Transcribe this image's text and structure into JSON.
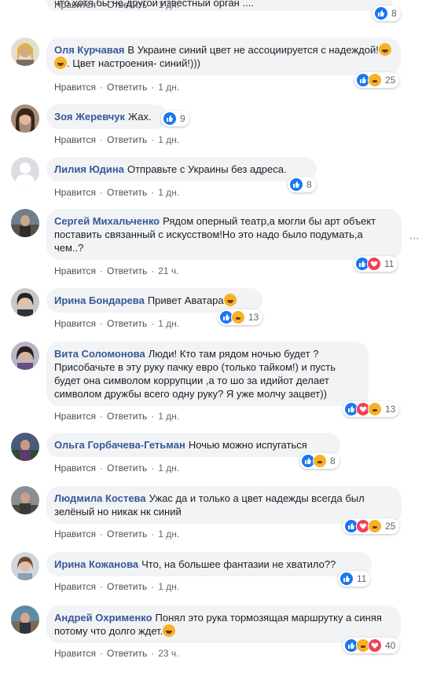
{
  "labels": {
    "like": "Нравится",
    "reply": "Ответить",
    "dot": "·",
    "more": "···"
  },
  "comments": [
    {
      "author": "",
      "text": "что хотя бы не другой известный орган ....",
      "time": "1 дн.",
      "count": "8"
    },
    {
      "author": "Оля Курчавая",
      "text": "В Украине синий цвет не ассоциируется с надеждой!",
      "text2": ". Цвет настроения- синий!)))",
      "time": "1 дн.",
      "count": "25"
    },
    {
      "author": "Зоя Жеревчук",
      "text": "Жах.",
      "time": "1 дн.",
      "count": "9"
    },
    {
      "author": "Лилия Юдина",
      "text": "Отправьте с Украины без адреса.",
      "time": "1 дн.",
      "count": "8"
    },
    {
      "author": "Сергей Михальченко",
      "text": "Рядом оперный театр,а могли бы арт объект поставить связанный с искусством!Но это надо было подумать,а чем..?",
      "time": "21 ч.",
      "count": "11"
    },
    {
      "author": "Ирина Бондарева",
      "text": "Привет Аватара",
      "time": "1 дн.",
      "count": "13"
    },
    {
      "author": "Вита Соломонова",
      "text": "Люди! Кто там рядом ночью будет ? Присобачьте в эту руку пачку евро (только тайком!) и пусть будет она символом коррупции ,а то шо за идийот делает символом дружбы всего одну руку? Я уже молчу зацвет))",
      "time": "1 дн.",
      "count": "13"
    },
    {
      "author": "Ольга Горбачева-Гетьман",
      "text": "Ночью можно испугаться",
      "time": "1 дн.",
      "count": "8"
    },
    {
      "author": "Людмила Костева",
      "text": "Ужас да и только а цвет надежды всегда был зелёный но никак нк синий",
      "time": "1 дн.",
      "count": "25"
    },
    {
      "author": "Ирина Кожанова",
      "text": "Что, на большее фантазии не хватило??",
      "time": "1 дн.",
      "count": "11"
    },
    {
      "author": "Андрей Охрименко",
      "text": "Понял это рука тормозящая маршрутку а синяя потому что долго ждет.",
      "time": "23 ч.",
      "count": "40"
    }
  ],
  "colors": {
    "author": "#385898",
    "like": "#1877f2",
    "love": "#f33e58",
    "haha": "#f7b125",
    "bubble": "#f2f3f5"
  }
}
